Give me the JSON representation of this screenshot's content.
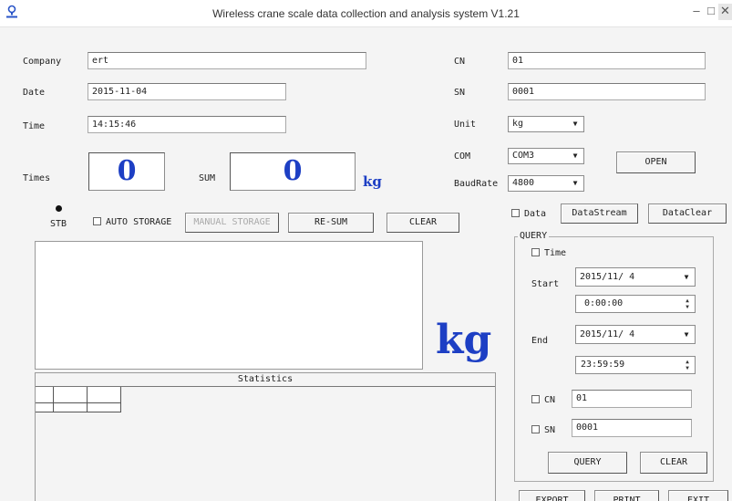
{
  "window": {
    "title": "Wireless crane scale data collection and analysis system V1.21",
    "minimize_glyph": "–",
    "maximize_glyph": "□",
    "close_glyph": "✕"
  },
  "icons": {
    "app": "app-icon",
    "minimize": "minimize-icon",
    "maximize": "maximize-icon",
    "close": "close-icon",
    "dropdown": "dropdown-arrow-icon",
    "spinner": "spinner-arrows-icon"
  },
  "colors": {
    "weight_value": "#1d3fc4",
    "window_bg": "#f4f4f4"
  },
  "form": {
    "company_label": "Company",
    "company_value": "ert",
    "date_label": "Date",
    "date_value": "2015-11-04",
    "time_label": "Time",
    "time_value": "14:15:46",
    "cn_label": "CN",
    "cn_value": "01",
    "sn_label": "SN",
    "sn_value": "0001",
    "unit_label": "Unit",
    "unit_value": "kg",
    "com_label": "COM",
    "com_value": "COM3",
    "baudrate_label": "BaudRate",
    "baudrate_value": "4800",
    "open_button": "OPEN"
  },
  "counters": {
    "times_label": "Times",
    "times_value": "0",
    "sum_label": "SUM",
    "sum_value": "0",
    "sum_unit": "kg"
  },
  "controls": {
    "stb_label": "STB",
    "auto_storage": "AUTO STORAGE",
    "manual_storage": "MANUAL STORAGE",
    "re_sum": "RE-SUM",
    "clear": "CLEAR"
  },
  "display": {
    "unit": "kg"
  },
  "statistics": {
    "title": "Statistics"
  },
  "data_panel": {
    "data_checkbox": "Data",
    "datastream_button": "DataStream",
    "dataclear_button": "DataClear"
  },
  "query": {
    "title": "QUERY",
    "time_checkbox": "Time",
    "start_label": "Start",
    "start_date": "2015/11/ 4",
    "start_time": "0:00:00",
    "end_label": "End",
    "end_date": "2015/11/ 4",
    "end_time": "23:59:59",
    "cn_checkbox": "CN",
    "cn_value": "01",
    "sn_checkbox": "SN",
    "sn_value": "0001",
    "query_button": "QUERY",
    "clear_button": "CLEAR"
  },
  "footer": {
    "export": "EXPORT",
    "print": "PRINT",
    "exit": "EXIT"
  }
}
